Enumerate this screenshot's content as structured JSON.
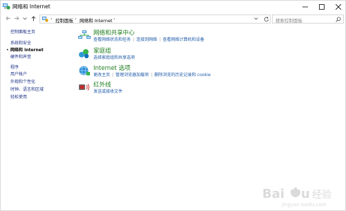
{
  "window": {
    "title": "网络和 Internet",
    "controls": [
      "minimize",
      "maximize",
      "close"
    ]
  },
  "nav": {
    "back_icon": "back-arrow-icon",
    "forward_icon": "forward-arrow-icon",
    "recent_icon": "chevron-down-icon",
    "up_icon": "up-arrow-icon"
  },
  "address": {
    "crumbs": [
      "控制面板",
      "网络和 Internet"
    ],
    "separator": "›"
  },
  "search": {
    "placeholder": "搜索控制面板"
  },
  "sidebar": {
    "items": [
      {
        "label": "控制面板主页",
        "active": false
      },
      {
        "label": "系统和安全",
        "active": false
      },
      {
        "label": "网络和 Internet",
        "active": true
      },
      {
        "label": "硬件和声音",
        "active": false
      },
      {
        "label": "程序",
        "active": false
      },
      {
        "label": "用户帐户",
        "active": false
      },
      {
        "label": "外观和个性化",
        "active": false
      },
      {
        "label": "时钟、语言和区域",
        "active": false
      },
      {
        "label": "轻松使用",
        "active": false
      }
    ]
  },
  "categories": [
    {
      "title": "网络和共享中心",
      "icon": "network-sharing-icon",
      "links": [
        "查看网络状态和任务",
        "连接到网络",
        "查看网络计算机和设备"
      ]
    },
    {
      "title": "家庭组",
      "icon": "homegroup-icon",
      "links": [
        "选择家庭组和共享选项"
      ]
    },
    {
      "title": "Internet 选项",
      "icon": "internet-options-icon",
      "links": [
        "更改主页",
        "管理浏览器加载项",
        "删除浏览的历史记录和 cookie"
      ]
    },
    {
      "title": "红外线",
      "icon": "infrared-icon",
      "links": [
        "发送或接收文件"
      ]
    }
  ],
  "colors": {
    "category_title": "#1e7d1e",
    "link": "#1e5aa8",
    "sidebar_link": "#1e3287"
  },
  "watermark": {
    "text": "Baidu 经验",
    "url_text": "jingyan.baidu.com"
  }
}
